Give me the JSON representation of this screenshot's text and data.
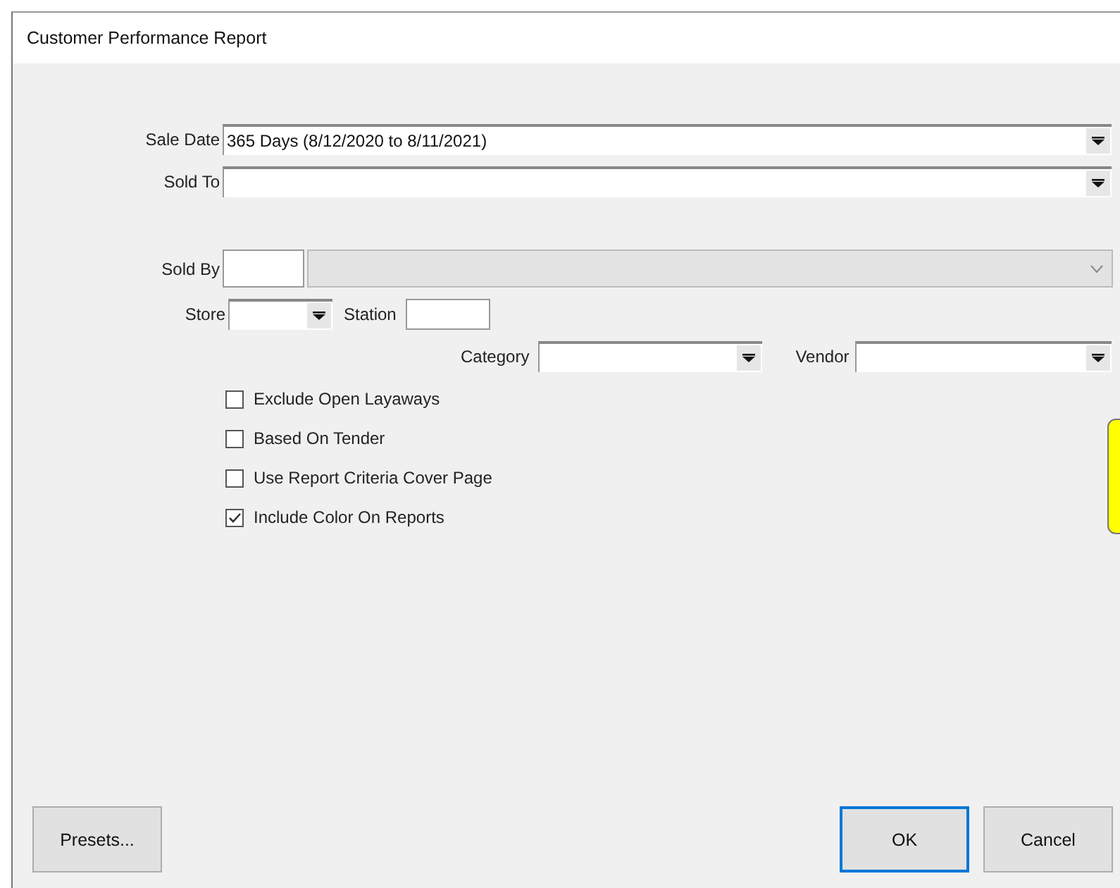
{
  "window": {
    "title": "Customer Performance Report"
  },
  "sale_date": {
    "label": "Sale Date",
    "value": "365 Days (8/12/2020 to 8/11/2021)"
  },
  "sold_to": {
    "label": "Sold To"
  },
  "sold_by": {
    "label": "Sold By",
    "disabled": true
  },
  "store": {
    "label": "Store"
  },
  "station": {
    "label": "Station"
  },
  "category": {
    "label": "Category"
  },
  "vendor": {
    "label": "Vendor"
  },
  "options": [
    {
      "label": "Exclude Open Layaways",
      "checked": false
    },
    {
      "label": "Based On Tender",
      "checked": false
    },
    {
      "label": "Use Report Criteria Cover Page",
      "checked": false
    },
    {
      "label": "Include Color On Reports",
      "checked": true
    }
  ],
  "buttons": [
    {
      "label": "Presets...",
      "kind": "secondary"
    },
    {
      "label": "OK",
      "kind": "default"
    },
    {
      "label": "Cancel",
      "kind": "secondary"
    }
  ]
}
